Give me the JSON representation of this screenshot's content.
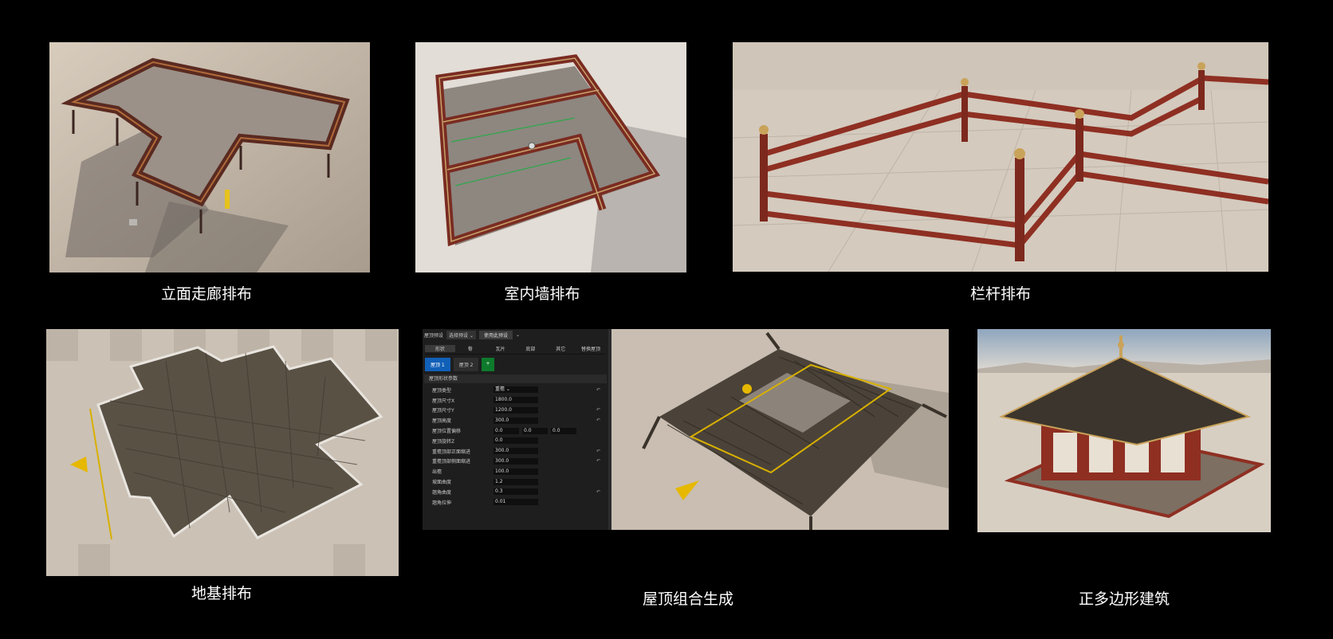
{
  "captions": {
    "facade_corridor": "立面走廊排布",
    "interior_wall": "室内墙排布",
    "railing": "栏杆排布",
    "foundation": "地基排布",
    "roof_combo": "屋顶组合生成",
    "polygon_building": "正多边形建筑"
  },
  "roof_ui": {
    "toolbar": {
      "preset_label": "屋顶预设",
      "select_preset": "选择预设 ⌄",
      "use_preset": "使用此预设",
      "chevron": "⌄"
    },
    "tabs": [
      "形状",
      "脊",
      "瓦片",
      "底部",
      "其它",
      "替换屋顶"
    ],
    "roof_tabs": [
      "屋顶 1",
      "屋顶 2",
      "+"
    ],
    "section_title": "屋顶形状参数",
    "rows": [
      {
        "label": "屋顶类型",
        "value": "重檐 ⌄",
        "reset": true
      },
      {
        "label": "屋顶尺寸X",
        "value": "1800.0",
        "reset": false
      },
      {
        "label": "屋顶尺寸Y",
        "value": "1200.0",
        "reset": true
      },
      {
        "label": "屋顶高度",
        "value": "300.0",
        "reset": true
      },
      {
        "label": "屋顶位置偏移",
        "values": [
          "0.0",
          "0.0",
          "0.0"
        ],
        "reset": false
      },
      {
        "label": "屋顶旋转Z",
        "value": "0.0",
        "reset": false
      },
      {
        "label": "重檐顶部正面缩进",
        "value": "300.0",
        "reset": true
      },
      {
        "label": "重檐顶部侧面缩进",
        "value": "300.0",
        "reset": true
      },
      {
        "label": "出檐",
        "value": "100.0",
        "reset": false
      },
      {
        "label": "坡面曲度",
        "value": "1.2",
        "reset": false
      },
      {
        "label": "翘角曲度",
        "value": "0.3",
        "reset": true
      },
      {
        "label": "翘角拉伸",
        "value": "0.01",
        "reset": false
      }
    ],
    "reset_icon": "↶"
  },
  "colors": {
    "background": "#000000",
    "floor": "#c9beb0",
    "timber_red": "#8e2f22",
    "roof_tile": "#4a4238",
    "accent_blue": "#1160b8",
    "accent_green": "#0e7a2c"
  }
}
